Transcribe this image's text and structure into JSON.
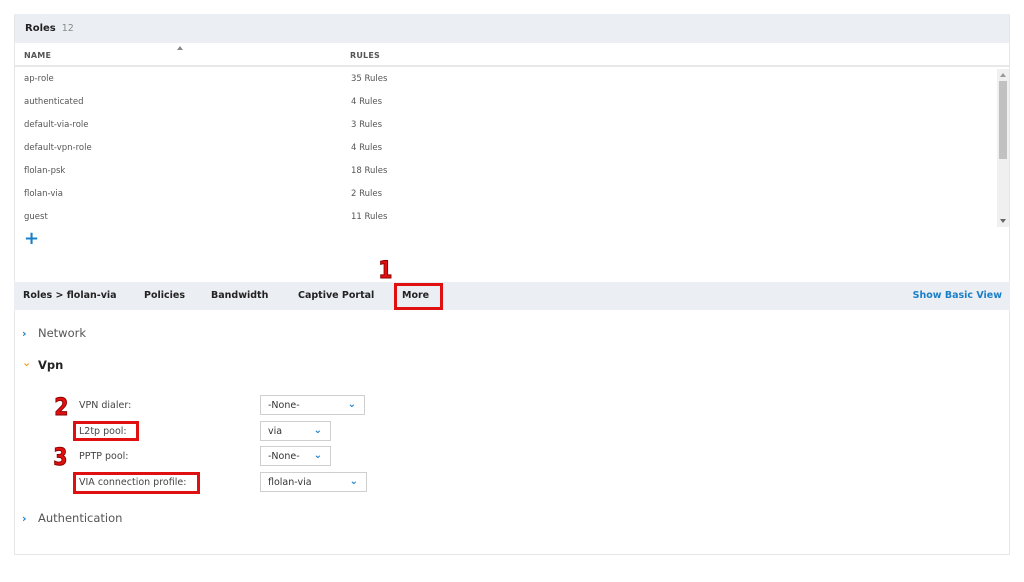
{
  "roles_panel": {
    "title": "Roles",
    "count": "12",
    "columns": {
      "name": "NAME",
      "rules": "RULES"
    },
    "rows": [
      {
        "name": "ap-role",
        "rules": "35 Rules"
      },
      {
        "name": "authenticated",
        "rules": "4 Rules"
      },
      {
        "name": "default-via-role",
        "rules": "3 Rules"
      },
      {
        "name": "default-vpn-role",
        "rules": "4 Rules"
      },
      {
        "name": "flolan-psk",
        "rules": "18 Rules"
      },
      {
        "name": "flolan-via",
        "rules": "2 Rules"
      },
      {
        "name": "guest",
        "rules": "11 Rules"
      }
    ],
    "add_icon": "+"
  },
  "tabbar": {
    "breadcrumb": "Roles > flolan-via",
    "tabs": [
      "Policies",
      "Bandwidth",
      "Captive Portal",
      "More"
    ],
    "show_basic_view": "Show Basic View"
  },
  "sections": {
    "network": {
      "label": "Network",
      "chevron": "›",
      "expanded": false
    },
    "vpn": {
      "label": "Vpn",
      "chevron": "⌄",
      "expanded": true
    },
    "authentication": {
      "label": "Authentication",
      "chevron": "›",
      "expanded": false
    }
  },
  "vpn_form": {
    "fields": [
      {
        "label": "VPN dialer:",
        "value": "-None-"
      },
      {
        "label": "L2tp pool:",
        "value": "via"
      },
      {
        "label": "PPTP pool:",
        "value": "-None-"
      },
      {
        "label": "VIA connection profile:",
        "value": "flolan-via"
      }
    ],
    "caret": "⌄"
  },
  "annotations": [
    "1",
    "2",
    "3"
  ],
  "colors": {
    "accent": "#1a7fc9",
    "expanded_chevron": "#f39c32",
    "highlight": "#e01010",
    "header_bg": "#ebeef2"
  }
}
